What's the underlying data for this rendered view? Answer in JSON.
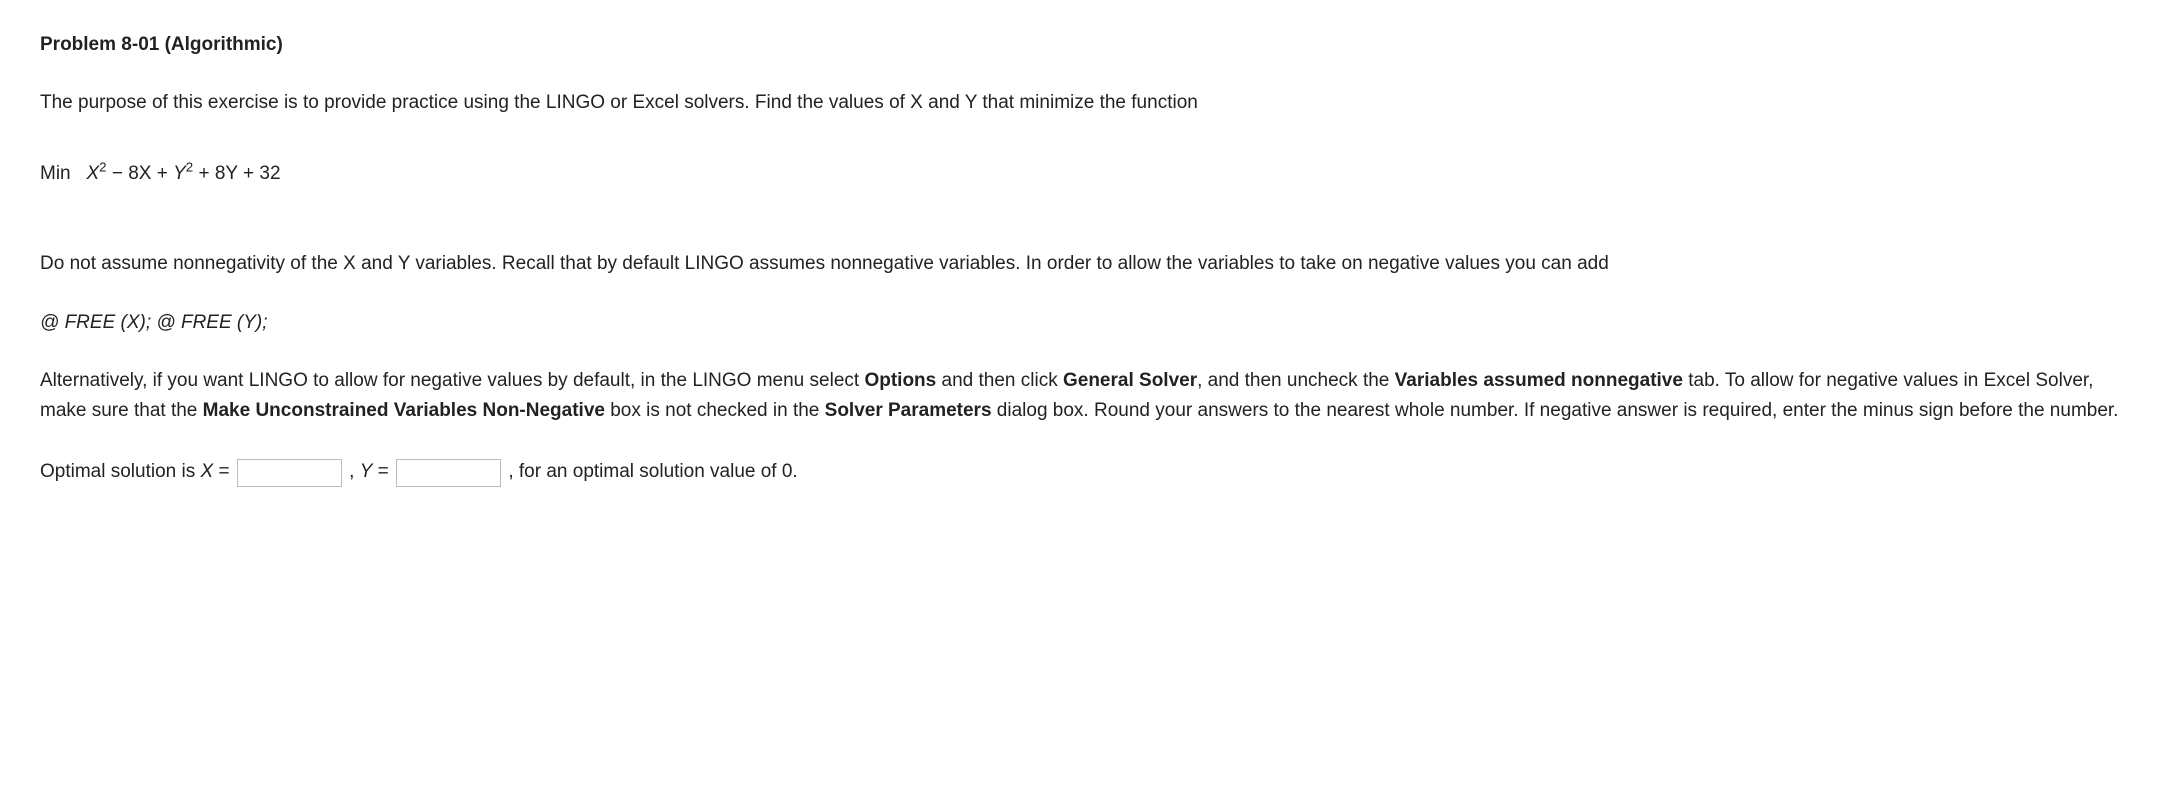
{
  "heading": "Problem 8-01 (Algorithmic)",
  "intro": "The purpose of this exercise is to provide practice using the LINGO or Excel solvers. Find the values of X and Y that minimize the function",
  "formula": {
    "label": "Min",
    "expr_parts": {
      "p1": " − 8X + ",
      "p2": " + 8Y + 32"
    }
  },
  "para2": "Do not assume nonnegativity of the X and Y variables. Recall that by default LINGO assumes nonnegative variables. In order to allow the variables to take on negative values you can add",
  "free_code": "@ FREE (X); @ FREE (Y);",
  "para3": {
    "t1": "Alternatively, if you want LINGO to allow for negative values by default, in the LINGO menu select ",
    "b1": "Options",
    "t2": " and then click ",
    "b2": "General Solver",
    "t3": ", and then uncheck the ",
    "b3": "Variables assumed nonnegative",
    "t4": " tab. To allow for negative values in Excel Solver, make sure that the ",
    "b4": "Make Unconstrained Variables Non-Negative",
    "t5": " box is not checked in the ",
    "b5": "Solver Parameters",
    "t6": " dialog box. Round your answers to the nearest whole number. If negative answer is required, enter the minus sign before the number."
  },
  "answer": {
    "prefix": "Optimal solution is ",
    "xvar": "X",
    "eq1": " = ",
    "sep": " , ",
    "yvar": "Y",
    "eq2": " = ",
    "suffix": " , for an optimal solution value of 0."
  },
  "inputs": {
    "x_value": "",
    "y_value": ""
  }
}
